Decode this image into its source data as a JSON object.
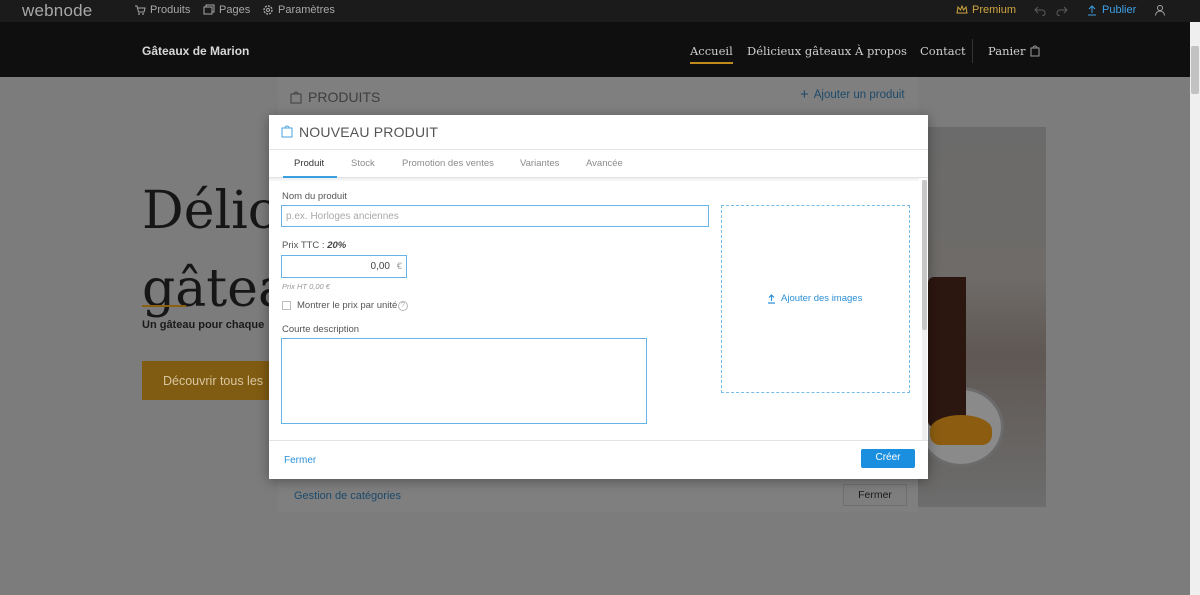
{
  "editor": {
    "logo": "webnode",
    "products": "Produits",
    "pages": "Pages",
    "settings": "Paramètres",
    "premium": "Premium",
    "publish": "Publier"
  },
  "site": {
    "title": "Gâteaux de Marion",
    "nav": [
      "Accueil",
      "Délicieux gâteaux",
      "À propos",
      "Contact",
      "Panier"
    ]
  },
  "hero": {
    "title_line1": "Délici",
    "title_line2": "gâtea",
    "subtitle": "Un gâteau pour chaque",
    "button": "Découvrir tous les"
  },
  "products_panel": {
    "title": "PRODUITS",
    "add": "Ajouter un produit",
    "categories": "Gestion de catégories",
    "close": "Fermer"
  },
  "modal": {
    "title": "NOUVEAU PRODUIT",
    "tabs": [
      "Produit",
      "Stock",
      "Promotion des ventes",
      "Variantes",
      "Avancée"
    ],
    "name_label": "Nom du produit",
    "name_placeholder": "p.ex. Horloges anciennes",
    "price_label": "Prix TTC :",
    "tax_rate": "20%",
    "price_value": "0,00",
    "currency": "€",
    "price_ht": "Prix HT 0,00 €",
    "unit_price_label": "Montrer le prix par unité",
    "help": "?",
    "short_desc_label": "Courte description",
    "add_images": "Ajouter des images",
    "close": "Fermer",
    "create": "Créer"
  },
  "colors": {
    "accent": "#1a8fe0",
    "field_border": "#67b5e6",
    "gold": "#c18a1c"
  }
}
